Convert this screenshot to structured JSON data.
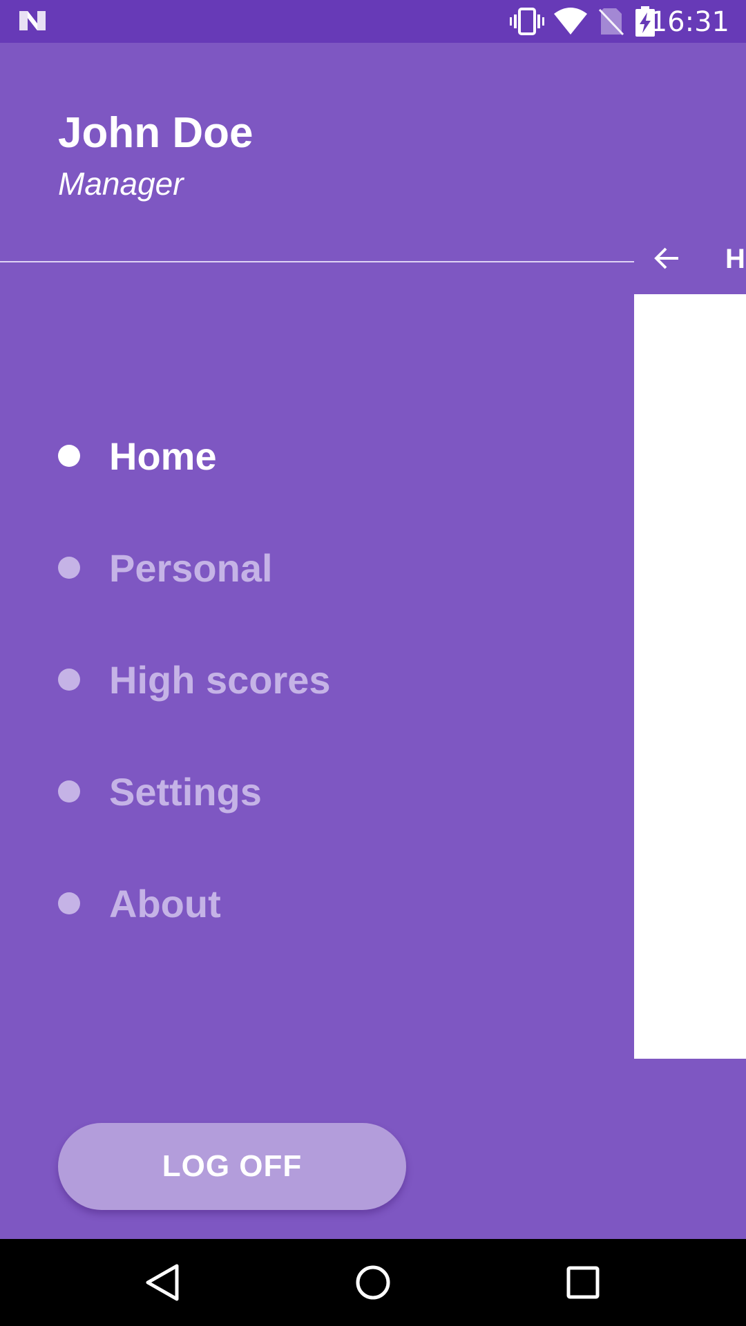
{
  "status_bar": {
    "time": "16:31",
    "icons": [
      "notification-n-icon",
      "vibrate-icon",
      "wifi-icon",
      "no-sim-icon",
      "battery-charging-icon"
    ],
    "background": "#673ab7"
  },
  "drawer": {
    "background": "#7e57c2",
    "user_name": "John Doe",
    "user_role": "Manager",
    "menu": [
      {
        "label": "Home",
        "active": true
      },
      {
        "label": "Personal",
        "active": false
      },
      {
        "label": "High scores",
        "active": false
      },
      {
        "label": "Settings",
        "active": false
      },
      {
        "label": "About",
        "active": false
      }
    ],
    "logoff_label": "LOG OFF"
  },
  "content": {
    "toolbar_title": "Home",
    "back_icon": "arrow-back-icon"
  },
  "nav_bar": {
    "icons": [
      "back-triangle-icon",
      "home-circle-icon",
      "recents-square-icon"
    ]
  },
  "colors": {
    "accent": "#7e57c2",
    "status": "#673ab7",
    "active_text": "#ffffff",
    "inactive_text": "#c5b3e6",
    "button": "#b39ddb"
  }
}
